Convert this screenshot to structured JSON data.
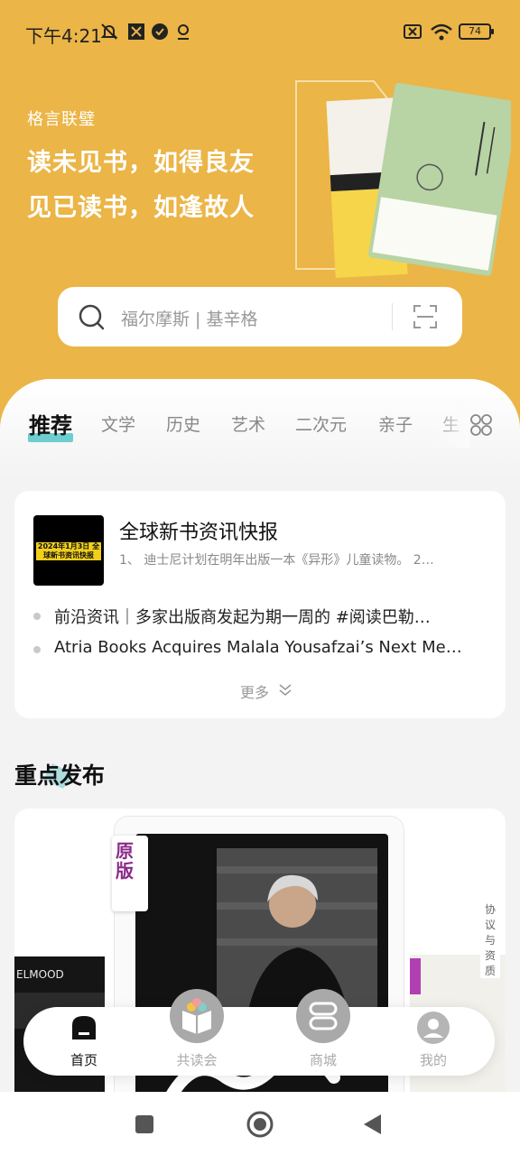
{
  "status_bar": {
    "time": "下午4:21",
    "battery": "74",
    "icons": [
      "mute-icon",
      "app-notification-icon",
      "verified-icon",
      "location-icon",
      "sim-off-icon",
      "wifi-icon",
      "battery-icon"
    ]
  },
  "hero": {
    "brand": "格言联璧",
    "slogan_line1": "读未见书，如得良友",
    "slogan_line2": "见已读书，如逢故人"
  },
  "search": {
    "placeholder": "福尔摩斯 | 基辛格",
    "icons": [
      "search-icon",
      "scan-icon"
    ]
  },
  "tabs": {
    "items": [
      "推荐",
      "文学",
      "历史",
      "艺术",
      "二次元",
      "亲子",
      "生"
    ],
    "active": "推荐",
    "more_icon": "grid-icon"
  },
  "news": {
    "thumb_text": "2024年1月3日 全球新书资讯快报",
    "title": "全球新书资讯快报",
    "subtitle": "1、 迪士尼计划在明年出版一本《异形》儿童读物。 2…",
    "items": [
      "前沿资讯｜多家出版商发起为期一周的 #阅读巴勒…",
      "Atria Books Acquires Malala Yousafzai’s Next Me…"
    ],
    "more_label": "更多"
  },
  "featured": {
    "section_title": "重点发布",
    "badge": "原版",
    "side_note": "协议与资质"
  },
  "bottom_nav": {
    "items": [
      {
        "label": "首页",
        "icon": "home-icon",
        "active": true
      },
      {
        "label": "共读会",
        "icon": "book-club-icon",
        "active": false
      },
      {
        "label": "商城",
        "icon": "store-icon",
        "active": false
      },
      {
        "label": "我的",
        "icon": "profile-icon",
        "active": false
      }
    ]
  },
  "colors": {
    "header_background": "#ebb547",
    "tab_accent": "#3fbfc2"
  }
}
